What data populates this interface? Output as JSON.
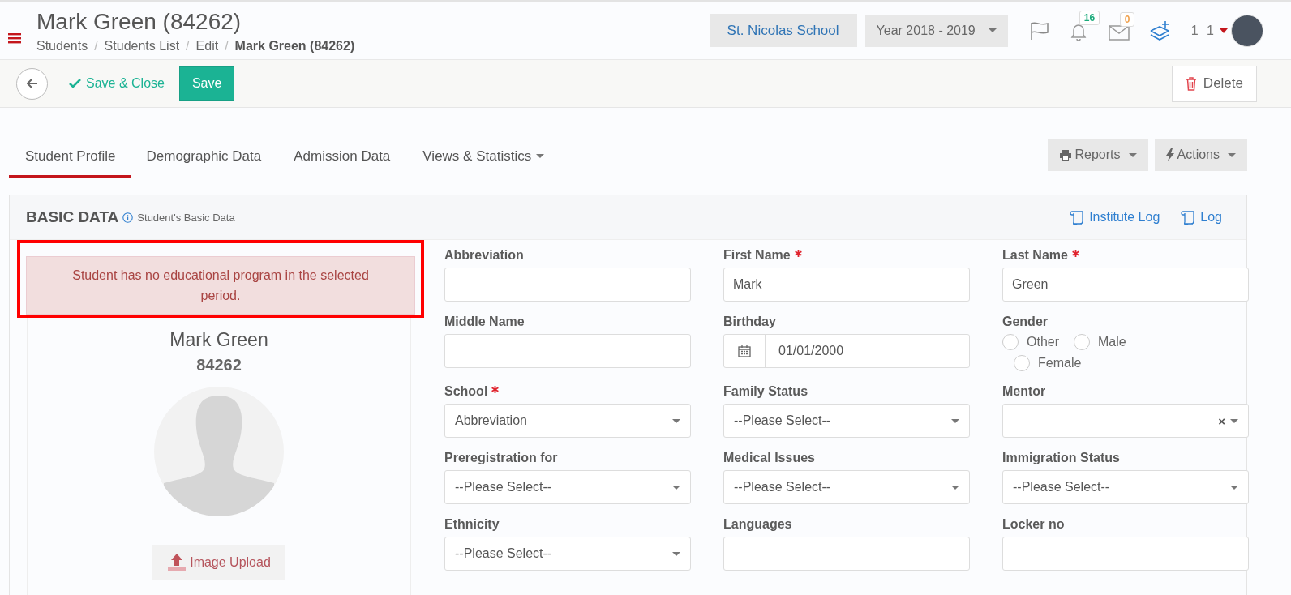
{
  "header": {
    "title": "Mark Green (84262)",
    "separator": "/",
    "breadcrumbs": [
      {
        "label": "Students",
        "current": false
      },
      {
        "label": "Students List",
        "current": false
      },
      {
        "label": "Edit",
        "current": false
      },
      {
        "label": "Mark Green (84262)",
        "current": true
      }
    ],
    "school": "St. Nicolas School",
    "year": "Year 2018 - 2019",
    "notifications": [
      {
        "kind": "bell",
        "count": "16",
        "color": "#1aaa7a"
      },
      {
        "kind": "mail",
        "count": "0",
        "color": "#f0a04b"
      }
    ],
    "user": "1 1"
  },
  "toolbar": {
    "save_close": "Save & Close",
    "save": "Save",
    "delete": "Delete"
  },
  "tabs": [
    {
      "label": "Student Profile",
      "selected": true,
      "dropdown": false
    },
    {
      "label": "Demographic Data",
      "selected": false,
      "dropdown": false
    },
    {
      "label": "Admission Data",
      "selected": false,
      "dropdown": false
    },
    {
      "label": "Views & Statistics",
      "selected": false,
      "dropdown": true
    }
  ],
  "tab_actions": [
    {
      "kind": "print",
      "label": "Reports"
    },
    {
      "kind": "bolt",
      "label": "Actions"
    }
  ],
  "section": {
    "title": "BASIC DATA",
    "subtitle": "Student's Basic Data",
    "links": [
      "Institute Log",
      "Log"
    ]
  },
  "profile": {
    "alert": "Student has no educational program in the selected period.",
    "name": "Mark Green",
    "id": "84262",
    "upload": "Image Upload"
  },
  "fields": [
    {
      "label": "Abbreviation",
      "required": false,
      "kind": "text"
    },
    {
      "label": "First Name",
      "required": true,
      "kind": "text",
      "value": "Mark"
    },
    {
      "label": "Last Name",
      "required": true,
      "kind": "text",
      "value": "Green"
    },
    {
      "label": "Middle Name",
      "required": false,
      "kind": "text"
    },
    {
      "label": "Birthday",
      "required": false,
      "kind": "date",
      "value": "01/01/2000"
    },
    {
      "label": "Gender",
      "required": false,
      "kind": "radio",
      "options": [
        {
          "label": "Other",
          "selected": false
        },
        {
          "label": "Male",
          "selected": false
        },
        {
          "label": "Female",
          "selected": false
        }
      ]
    },
    {
      "label": "School",
      "required": true,
      "kind": "select",
      "value": "Abbreviation"
    },
    {
      "label": "Family Status",
      "required": false,
      "kind": "select",
      "value": "--Please Select--"
    },
    {
      "label": "Mentor",
      "required": false,
      "kind": "combo",
      "clear": "×"
    },
    {
      "label": "Preregistration for",
      "required": false,
      "kind": "select",
      "value": "--Please Select--"
    },
    {
      "label": "Medical Issues",
      "required": false,
      "kind": "select",
      "value": "--Please Select--"
    },
    {
      "label": "Immigration Status",
      "required": false,
      "kind": "select",
      "value": "--Please Select--"
    },
    {
      "label": "Ethnicity",
      "required": false,
      "kind": "select",
      "value": "--Please Select--"
    },
    {
      "label": "Languages",
      "required": false,
      "kind": "text"
    },
    {
      "label": "Locker no",
      "required": false,
      "kind": "text"
    }
  ]
}
